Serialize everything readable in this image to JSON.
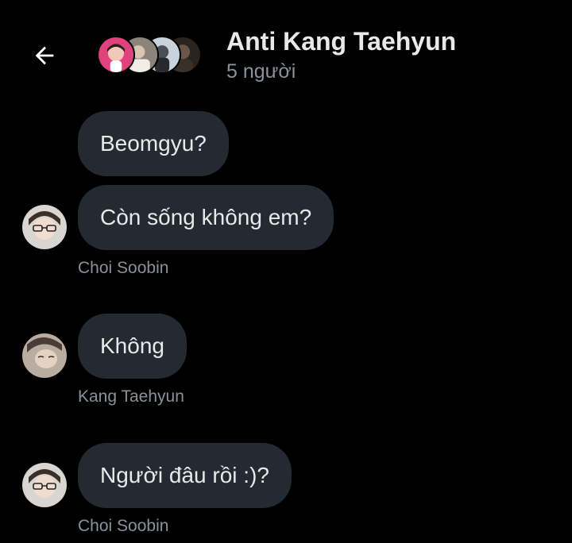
{
  "header": {
    "back_icon": "arrow-left-icon",
    "title": "Anti Kang Taehyun",
    "member_count": "5 người"
  },
  "messages": [
    {
      "text": "Beomgyu?"
    },
    {
      "text": "Còn sống không em?",
      "sender": "Choi Soobin"
    },
    {
      "text": "Không",
      "sender": "Kang Taehyun"
    },
    {
      "text": "Người đâu rồi :)?",
      "sender": "Choi Soobin"
    }
  ],
  "colors": {
    "background": "#000000",
    "bubble": "#232a31",
    "text": "#e7e9ea",
    "muted": "#8b9196"
  }
}
